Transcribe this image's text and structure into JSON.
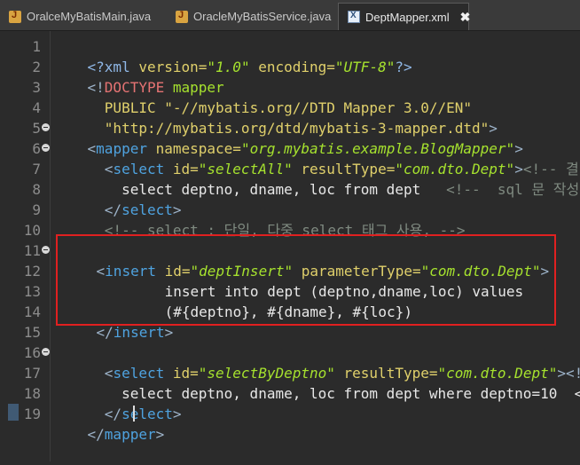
{
  "tabs": [
    {
      "label": "OralceMyBatisMain.java",
      "icon": "java-file-icon",
      "active": false
    },
    {
      "label": "OracleMyBatisService.java",
      "icon": "java-file-icon",
      "active": false
    },
    {
      "label": "DeptMapper.xml",
      "icon": "xml-file-icon",
      "active": true,
      "close": "✖"
    }
  ],
  "line_numbers": [
    "1",
    "2",
    "3",
    "4",
    "5",
    "6",
    "7",
    "8",
    "9",
    "10",
    "11",
    "12",
    "13",
    "14",
    "15",
    "16",
    "17",
    "18",
    "19"
  ],
  "code": {
    "l1": {
      "a": "<?",
      "b": "xml",
      "c": " version=",
      "d": "\"1.0\"",
      "e": " encoding=",
      "f": "\"UTF-8\"",
      "g": "?>"
    },
    "l2": {
      "a": "<!",
      "b": "DOCTYPE",
      "c": " mapper"
    },
    "l3": {
      "a": "  PUBLIC ",
      "b": "\"-//mybatis.org//DTD Mapper 3.0//EN\""
    },
    "l4": {
      "a": "  \"http://mybatis.org/dtd/mybatis-3-mapper.dtd\"",
      "b": ">"
    },
    "l5": {
      "a": "<",
      "b": "mapper",
      "c": " namespace=",
      "d": "\"org.mybatis.example.BlogMapper\"",
      "e": ">"
    },
    "l6": {
      "a": "  <",
      "b": "select",
      "c": " id=",
      "d": "\"selectAll\"",
      "e": " resultType=",
      "f": "\"com.dto.Dept\"",
      "g": ">",
      "h": "<!-- 결"
    },
    "l7": {
      "a": "    select deptno, dname, loc from dept   ",
      "b": "<!--  sql 문 작성 ,"
    },
    "l8": {
      "a": "  </",
      "b": "select",
      "c": ">"
    },
    "l9": {
      "a": "  <!-- select : 단일, 다중 select 태그 사용, -->"
    },
    "l10": {
      "a": ""
    },
    "l11": {
      "a": "<",
      "b": "insert",
      "c": " id=",
      "d": "\"deptInsert\"",
      "e": " parameterType=",
      "f": "\"com.dto.Dept\"",
      "g": ">"
    },
    "l12": {
      "a": "        insert into dept (deptno,dname,loc) values"
    },
    "l13": {
      "a": "        (#{deptno}, #{dname}, #{loc})"
    },
    "l14": {
      "a": "</",
      "b": "insert",
      "c": ">"
    },
    "l15": {
      "a": ""
    },
    "l16": {
      "a": "  <",
      "b": "select",
      "c": " id=",
      "d": "\"selectByDeptno\"",
      "e": " resultType=",
      "f": "\"com.dto.Dept\"",
      "g": "><!"
    },
    "l17": {
      "a": "    select deptno, dname, loc from dept where deptno=10  <"
    },
    "l18": {
      "a": "  </",
      "b": "select",
      "c": ">"
    },
    "l19": {
      "a": "</",
      "b": "mapper",
      "c": ">"
    }
  },
  "colors": {
    "highlight_border": "#e02020",
    "editor_bg": "#2b2b2b"
  }
}
